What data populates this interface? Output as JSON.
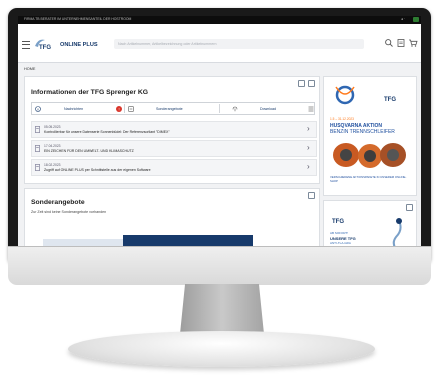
{
  "statusbar": {
    "left_text": "FIRMA TB BERATER IM UNTERNEHMENSANTEIL DER HOSTROOM",
    "right_text": "◂ ·"
  },
  "header": {
    "brand": "ONLINE PLUS",
    "logo_text": "TFG",
    "search_placeholder": "Nach Artikelnummer, Artikelbezeichnung oder Artikelnummern",
    "icons": [
      "search-icon",
      "document-icon",
      "cart-icon"
    ],
    "accent_color": "#173a6b"
  },
  "breadcrumb": "HOME",
  "info_card": {
    "title": "Informationen der TFG Sprenger KG",
    "tabs": [
      {
        "label": "Nachrichten",
        "icon": "info-icon"
      },
      {
        "label": "Sonderangebote",
        "icon": "alert-icon"
      },
      {
        "label": "Download",
        "icon": "download-icon"
      }
    ],
    "news": [
      {
        "date": "05.05.2023",
        "text": "Kontrollierbar für unsere Datenserie Sonnenbüdel: Der Referenzsorliant \"DIMEX\""
      },
      {
        "date": "17.04.2023",
        "text": "EIN ZEICHEN FÜR DEN UMWELT- UND KLIMASCHUTZ"
      },
      {
        "date": "18.02.2023",
        "text": "Zugriff auf ONLINE PLUS per Schnittstelle aus der eigenen Software"
      }
    ]
  },
  "offers_card": {
    "title": "Sonderangebote",
    "subtitle": "Zur Zeit sind keine Sonderangebote vorhanden"
  },
  "ad_top": {
    "logo_text": "TFG",
    "dates": "1.5 – 31.12.2023",
    "title_line1": "HUSQVARNA AKTION",
    "title_line2": "BENZIN TRENNSCHLEIFER",
    "footer": "VERSCHIEDENE AKTIONSPAKETE IN UNSEREM ONLINE-SHOP"
  },
  "ad_bottom": {
    "logo_text": "TFG",
    "line1": "AB SOFORT!",
    "line2": "UNSERE TFG",
    "line3": "ANTI-TLA-GRA"
  }
}
